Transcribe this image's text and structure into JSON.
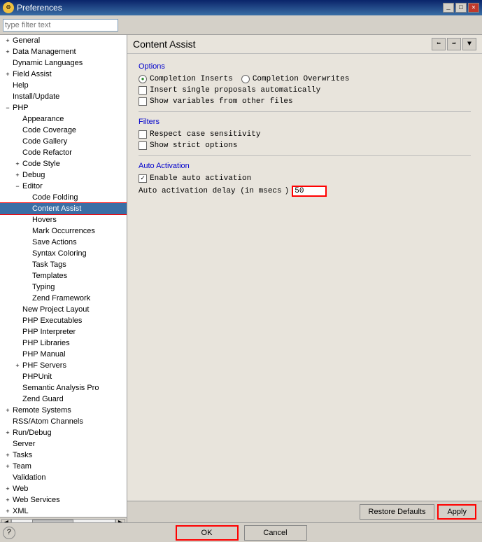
{
  "window": {
    "title": "Preferences",
    "icon": "⚙"
  },
  "toolbar": {
    "filter_placeholder": "type filter text"
  },
  "sidebar": {
    "items": [
      {
        "id": "general",
        "label": "General",
        "level": 1,
        "expandable": true,
        "expanded": false
      },
      {
        "id": "data-management",
        "label": "Data Management",
        "level": 1,
        "expandable": true,
        "expanded": false
      },
      {
        "id": "dynamic-languages",
        "label": "Dynamic Languages",
        "level": 1,
        "expandable": false,
        "expanded": false
      },
      {
        "id": "field-assist",
        "label": "Field Assist",
        "level": 1,
        "expandable": true,
        "expanded": false
      },
      {
        "id": "help",
        "label": "Help",
        "level": 1,
        "expandable": false,
        "expanded": false
      },
      {
        "id": "install-update",
        "label": "Install/Update",
        "level": 1,
        "expandable": false,
        "expanded": false
      },
      {
        "id": "php",
        "label": "PHP",
        "level": 1,
        "expandable": true,
        "expanded": true
      },
      {
        "id": "appearance",
        "label": "Appearance",
        "level": 2,
        "expandable": false
      },
      {
        "id": "code-coverage",
        "label": "Code Coverage",
        "level": 2,
        "expandable": false
      },
      {
        "id": "code-gallery",
        "label": "Code Gallery",
        "level": 2,
        "expandable": false
      },
      {
        "id": "code-refactor",
        "label": "Code Refactor",
        "level": 2,
        "expandable": false
      },
      {
        "id": "code-style",
        "label": "Code Style",
        "level": 2,
        "expandable": true,
        "expanded": false
      },
      {
        "id": "debug",
        "label": "Debug",
        "level": 2,
        "expandable": true,
        "expanded": false
      },
      {
        "id": "editor",
        "label": "Editor",
        "level": 2,
        "expandable": true,
        "expanded": true
      },
      {
        "id": "code-folding",
        "label": "Code Folding",
        "level": 3,
        "expandable": false
      },
      {
        "id": "content-assist",
        "label": "Content Assist",
        "level": 3,
        "expandable": false,
        "selected": true
      },
      {
        "id": "hovers",
        "label": "Hovers",
        "level": 3,
        "expandable": false
      },
      {
        "id": "mark-occurrences",
        "label": "Mark Occurrences",
        "level": 3,
        "expandable": false
      },
      {
        "id": "save-actions",
        "label": "Save Actions",
        "level": 3,
        "expandable": false
      },
      {
        "id": "syntax-coloring",
        "label": "Syntax Coloring",
        "level": 3,
        "expandable": false
      },
      {
        "id": "task-tags",
        "label": "Task Tags",
        "level": 3,
        "expandable": false
      },
      {
        "id": "templates",
        "label": "Templates",
        "level": 3,
        "expandable": false
      },
      {
        "id": "typing",
        "label": "Typing",
        "level": 3,
        "expandable": false
      },
      {
        "id": "zend-framework",
        "label": "Zend Framework",
        "level": 3,
        "expandable": false
      },
      {
        "id": "new-project-layout",
        "label": "New Project Layout",
        "level": 2,
        "expandable": false
      },
      {
        "id": "php-executables",
        "label": "PHP Executables",
        "level": 2,
        "expandable": false
      },
      {
        "id": "php-interpreter",
        "label": "PHP Interpreter",
        "level": 2,
        "expandable": false
      },
      {
        "id": "php-libraries",
        "label": "PHP Libraries",
        "level": 2,
        "expandable": false
      },
      {
        "id": "php-manual",
        "label": "PHP Manual",
        "level": 2,
        "expandable": false
      },
      {
        "id": "php-servers",
        "label": "PHF Servers",
        "level": 2,
        "expandable": true,
        "expanded": false
      },
      {
        "id": "phpunit",
        "label": "PHPUnit",
        "level": 2,
        "expandable": false
      },
      {
        "id": "semantic-analysis",
        "label": "Semantic Analysis Pro",
        "level": 2,
        "expandable": false
      },
      {
        "id": "zend-guard",
        "label": "Zend Guard",
        "level": 2,
        "expandable": false
      },
      {
        "id": "remote-systems",
        "label": "Remote Systems",
        "level": 1,
        "expandable": true,
        "expanded": false
      },
      {
        "id": "rss-atom",
        "label": "RSS/Atom Channels",
        "level": 1,
        "expandable": false
      },
      {
        "id": "run-debug",
        "label": "Run/Debug",
        "level": 1,
        "expandable": true,
        "expanded": false
      },
      {
        "id": "server",
        "label": "Server",
        "level": 1,
        "expandable": false
      },
      {
        "id": "tasks",
        "label": "Tasks",
        "level": 1,
        "expandable": true,
        "expanded": false
      },
      {
        "id": "team",
        "label": "Team",
        "level": 1,
        "expandable": true,
        "expanded": false
      },
      {
        "id": "validation",
        "label": "Validation",
        "level": 1,
        "expandable": false
      },
      {
        "id": "web",
        "label": "Web",
        "level": 1,
        "expandable": true,
        "expanded": false
      },
      {
        "id": "web-services",
        "label": "Web Services",
        "level": 1,
        "expandable": true,
        "expanded": false
      },
      {
        "id": "xml",
        "label": "XML",
        "level": 1,
        "expandable": true,
        "expanded": false
      }
    ]
  },
  "panel": {
    "title": "Content Assist",
    "sections": {
      "options": {
        "label": "Options",
        "radio1": "Completion Inserts",
        "radio2": "Completion Overwrites",
        "checkbox1": "Insert single proposals automatically",
        "checkbox2": "Show variables from other files"
      },
      "filters": {
        "label": "Filters",
        "checkbox1": "Respect case sensitivity",
        "checkbox2": "Show strict options"
      },
      "auto_activation": {
        "label": "Auto Activation",
        "checkbox1": "Enable auto activation",
        "delay_label": "Auto activation delay (in msecs",
        "delay_value": "50"
      }
    }
  },
  "buttons": {
    "restore_defaults": "Restore Defaults",
    "apply": "Apply",
    "ok": "OK",
    "cancel": "Cancel"
  }
}
